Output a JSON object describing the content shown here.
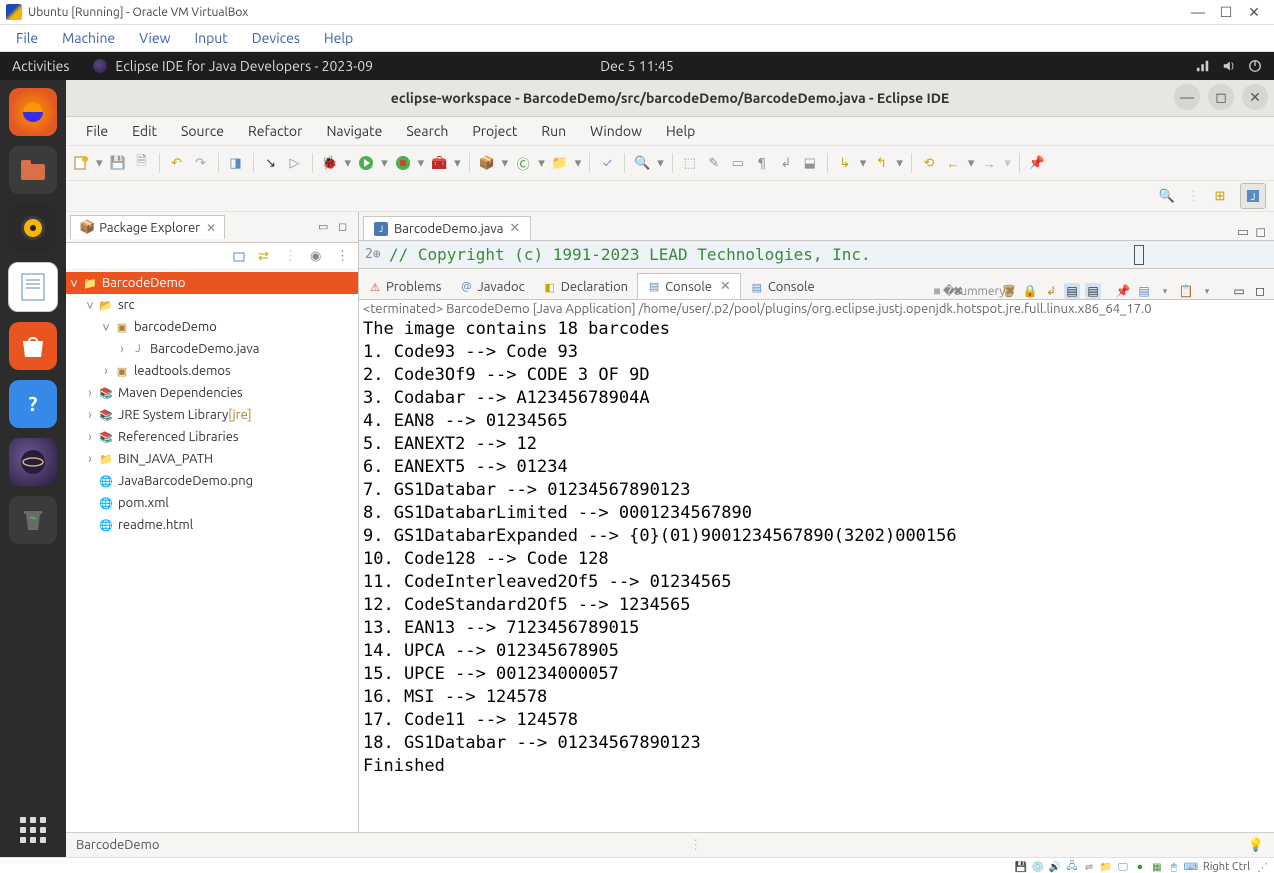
{
  "vbox": {
    "title": "Ubuntu [Running] - Oracle VM VirtualBox",
    "menu": [
      "File",
      "Machine",
      "View",
      "Input",
      "Devices",
      "Help"
    ],
    "status_key": "Right Ctrl"
  },
  "ubuntu_top": {
    "activities": "Activities",
    "app": "Eclipse IDE for Java Developers - 2023-09",
    "clock": "Dec 5  11:45"
  },
  "ide": {
    "title": "eclipse-workspace - BarcodeDemo/src/barcodeDemo/BarcodeDemo.java - Eclipse IDE",
    "menu": [
      "File",
      "Edit",
      "Source",
      "Refactor",
      "Navigate",
      "Search",
      "Project",
      "Run",
      "Window",
      "Help"
    ]
  },
  "pkg": {
    "title": "Package Explorer",
    "root": "BarcodeDemo",
    "nodes": {
      "src": "src",
      "pkg": "barcodeDemo",
      "file": "BarcodeDemo.java",
      "lead": "leadtools.demos",
      "maven": "Maven Dependencies",
      "jre": "JRE System Library ",
      "jre_suffix": "[jre]",
      "reflib": "Referenced Libraries",
      "bin": "BIN_JAVA_PATH",
      "png": "JavaBarcodeDemo.png",
      "pom": "pom.xml",
      "readme": "readme.html"
    }
  },
  "editor": {
    "tab": "BarcodeDemo.java",
    "line_no": "2",
    "code": "// Copyright (c) 1991-2023 LEAD Technologies, Inc."
  },
  "views": {
    "problems": "Problems",
    "javadoc": "Javadoc",
    "declaration": "Declaration",
    "console": "Console",
    "console2": "Console"
  },
  "console": {
    "path": "<terminated> BarcodeDemo [Java Application] /home/user/.p2/pool/plugins/org.eclipse.justj.openjdk.hotspot.jre.full.linux.x86_64_17.0",
    "output": "The image contains 18 barcodes\n1. Code93 --> Code 93\n2. Code3Of9 --> CODE 3 OF 9D\n3. Codabar --> A12345678904A\n4. EAN8 --> 01234565\n5. EANEXT2 --> 12\n6. EANEXT5 --> 01234\n7. GS1Databar --> 01234567890123\n8. GS1DatabarLimited --> 0001234567890\n9. GS1DatabarExpanded --> {0}(01)9001234567890(3202)000156\n10. Code128 --> Code 128\n11. CodeInterleaved2Of5 --> 01234565\n12. CodeStandard2Of5 --> 1234565\n13. EAN13 --> 7123456789015\n14. UPCA --> 012345678905\n15. UPCE --> 001234000057\n16. MSI --> 124578\n17. Code11 --> 124578\n18. GS1Databar --> 01234567890123\nFinished"
  },
  "status": {
    "text": "BarcodeDemo"
  }
}
